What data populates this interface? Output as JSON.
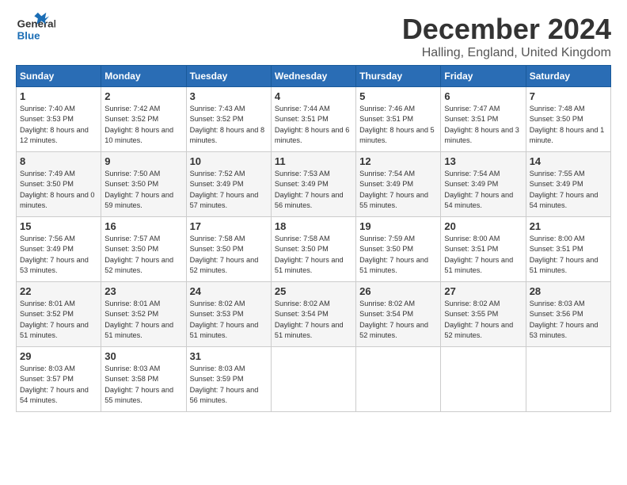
{
  "logo": {
    "line1": "General",
    "line2": "Blue"
  },
  "title": "December 2024",
  "subtitle": "Halling, England, United Kingdom",
  "days_of_week": [
    "Sunday",
    "Monday",
    "Tuesday",
    "Wednesday",
    "Thursday",
    "Friday",
    "Saturday"
  ],
  "weeks": [
    [
      {
        "day": "1",
        "sunrise": "7:40 AM",
        "sunset": "3:53 PM",
        "daylight": "8 hours and 12 minutes."
      },
      {
        "day": "2",
        "sunrise": "7:42 AM",
        "sunset": "3:52 PM",
        "daylight": "8 hours and 10 minutes."
      },
      {
        "day": "3",
        "sunrise": "7:43 AM",
        "sunset": "3:52 PM",
        "daylight": "8 hours and 8 minutes."
      },
      {
        "day": "4",
        "sunrise": "7:44 AM",
        "sunset": "3:51 PM",
        "daylight": "8 hours and 6 minutes."
      },
      {
        "day": "5",
        "sunrise": "7:46 AM",
        "sunset": "3:51 PM",
        "daylight": "8 hours and 5 minutes."
      },
      {
        "day": "6",
        "sunrise": "7:47 AM",
        "sunset": "3:51 PM",
        "daylight": "8 hours and 3 minutes."
      },
      {
        "day": "7",
        "sunrise": "7:48 AM",
        "sunset": "3:50 PM",
        "daylight": "8 hours and 1 minute."
      }
    ],
    [
      {
        "day": "8",
        "sunrise": "7:49 AM",
        "sunset": "3:50 PM",
        "daylight": "8 hours and 0 minutes."
      },
      {
        "day": "9",
        "sunrise": "7:50 AM",
        "sunset": "3:50 PM",
        "daylight": "7 hours and 59 minutes."
      },
      {
        "day": "10",
        "sunrise": "7:52 AM",
        "sunset": "3:49 PM",
        "daylight": "7 hours and 57 minutes."
      },
      {
        "day": "11",
        "sunrise": "7:53 AM",
        "sunset": "3:49 PM",
        "daylight": "7 hours and 56 minutes."
      },
      {
        "day": "12",
        "sunrise": "7:54 AM",
        "sunset": "3:49 PM",
        "daylight": "7 hours and 55 minutes."
      },
      {
        "day": "13",
        "sunrise": "7:54 AM",
        "sunset": "3:49 PM",
        "daylight": "7 hours and 54 minutes."
      },
      {
        "day": "14",
        "sunrise": "7:55 AM",
        "sunset": "3:49 PM",
        "daylight": "7 hours and 54 minutes."
      }
    ],
    [
      {
        "day": "15",
        "sunrise": "7:56 AM",
        "sunset": "3:49 PM",
        "daylight": "7 hours and 53 minutes."
      },
      {
        "day": "16",
        "sunrise": "7:57 AM",
        "sunset": "3:50 PM",
        "daylight": "7 hours and 52 minutes."
      },
      {
        "day": "17",
        "sunrise": "7:58 AM",
        "sunset": "3:50 PM",
        "daylight": "7 hours and 52 minutes."
      },
      {
        "day": "18",
        "sunrise": "7:58 AM",
        "sunset": "3:50 PM",
        "daylight": "7 hours and 51 minutes."
      },
      {
        "day": "19",
        "sunrise": "7:59 AM",
        "sunset": "3:50 PM",
        "daylight": "7 hours and 51 minutes."
      },
      {
        "day": "20",
        "sunrise": "8:00 AM",
        "sunset": "3:51 PM",
        "daylight": "7 hours and 51 minutes."
      },
      {
        "day": "21",
        "sunrise": "8:00 AM",
        "sunset": "3:51 PM",
        "daylight": "7 hours and 51 minutes."
      }
    ],
    [
      {
        "day": "22",
        "sunrise": "8:01 AM",
        "sunset": "3:52 PM",
        "daylight": "7 hours and 51 minutes."
      },
      {
        "day": "23",
        "sunrise": "8:01 AM",
        "sunset": "3:52 PM",
        "daylight": "7 hours and 51 minutes."
      },
      {
        "day": "24",
        "sunrise": "8:02 AM",
        "sunset": "3:53 PM",
        "daylight": "7 hours and 51 minutes."
      },
      {
        "day": "25",
        "sunrise": "8:02 AM",
        "sunset": "3:54 PM",
        "daylight": "7 hours and 51 minutes."
      },
      {
        "day": "26",
        "sunrise": "8:02 AM",
        "sunset": "3:54 PM",
        "daylight": "7 hours and 52 minutes."
      },
      {
        "day": "27",
        "sunrise": "8:02 AM",
        "sunset": "3:55 PM",
        "daylight": "7 hours and 52 minutes."
      },
      {
        "day": "28",
        "sunrise": "8:03 AM",
        "sunset": "3:56 PM",
        "daylight": "7 hours and 53 minutes."
      }
    ],
    [
      {
        "day": "29",
        "sunrise": "8:03 AM",
        "sunset": "3:57 PM",
        "daylight": "7 hours and 54 minutes."
      },
      {
        "day": "30",
        "sunrise": "8:03 AM",
        "sunset": "3:58 PM",
        "daylight": "7 hours and 55 minutes."
      },
      {
        "day": "31",
        "sunrise": "8:03 AM",
        "sunset": "3:59 PM",
        "daylight": "7 hours and 56 minutes."
      },
      null,
      null,
      null,
      null
    ]
  ]
}
